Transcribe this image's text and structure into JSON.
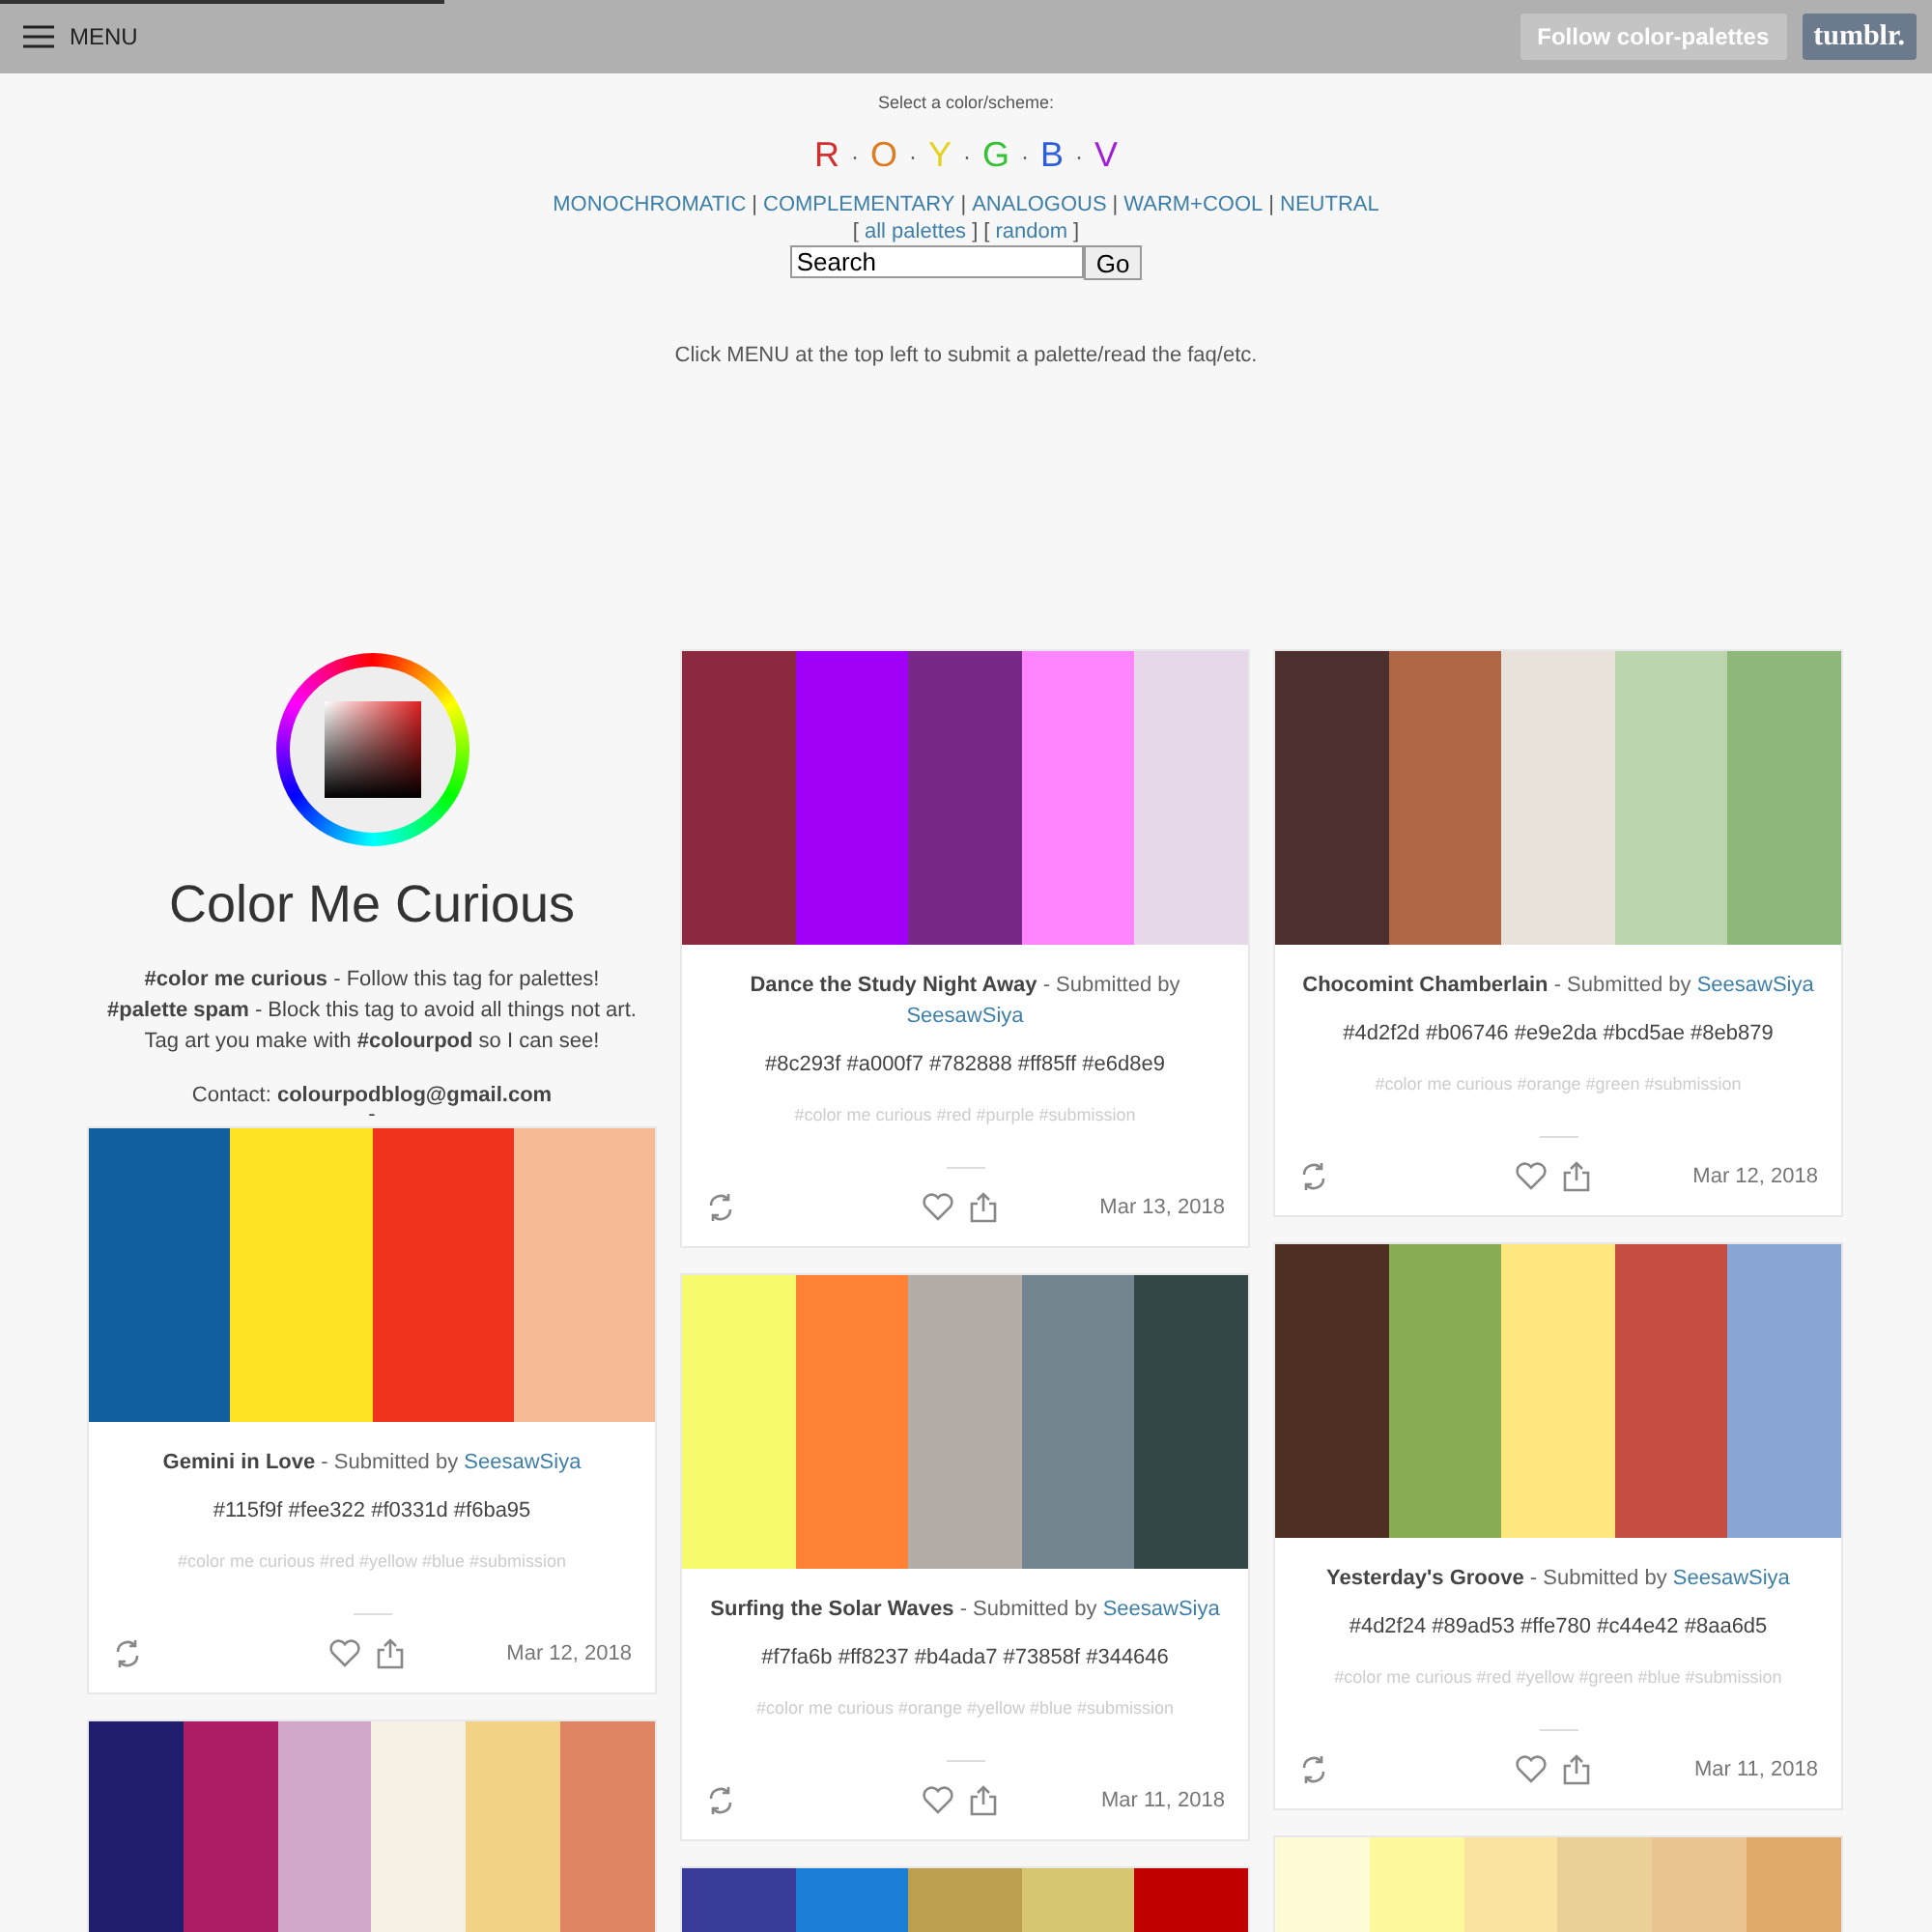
{
  "topbar": {
    "progress": {
      "level": 0.23
    },
    "menu_label": "MENU",
    "follow_button": "Follow color-palettes",
    "tumblr_button": "tumblr."
  },
  "header": {
    "prompt": "Select a color/scheme:",
    "letters": [
      {
        "kind": "letter",
        "text": "R",
        "color": "#d32f2f"
      },
      {
        "kind": "sep",
        "text": "·"
      },
      {
        "kind": "letter",
        "text": "O",
        "color": "#e07b20"
      },
      {
        "kind": "sep",
        "text": "·"
      },
      {
        "kind": "letter",
        "text": "Y",
        "color": "#e6d21c"
      },
      {
        "kind": "sep",
        "text": "·"
      },
      {
        "kind": "letter",
        "text": "G",
        "color": "#35c335"
      },
      {
        "kind": "sep",
        "text": "·"
      },
      {
        "kind": "letter",
        "text": "B",
        "color": "#2f5fd8"
      },
      {
        "kind": "sep",
        "text": "·"
      },
      {
        "kind": "letter",
        "text": "V",
        "color": "#a020d8"
      }
    ],
    "schemes": [
      {
        "kind": "link",
        "text": "MONOCHROMATIC"
      },
      {
        "kind": "sep",
        "text": "|"
      },
      {
        "kind": "link",
        "text": "COMPLEMENTARY"
      },
      {
        "kind": "sep",
        "text": "|"
      },
      {
        "kind": "link",
        "text": "ANALOGOUS"
      },
      {
        "kind": "sep",
        "text": "|"
      },
      {
        "kind": "link",
        "text": "WARM+COOL"
      },
      {
        "kind": "sep",
        "text": "|"
      },
      {
        "kind": "link",
        "text": "NEUTRAL"
      }
    ],
    "extra": [
      {
        "kind": "sep",
        "text": "["
      },
      {
        "kind": "link",
        "text": "all palettes"
      },
      {
        "kind": "sep",
        "text": "] ["
      },
      {
        "kind": "link",
        "text": "random"
      },
      {
        "kind": "sep",
        "text": "]"
      }
    ],
    "search": {
      "value": "Search",
      "button": "Go"
    },
    "note": "Click MENU at the top left to submit a palette/read the faq/etc."
  },
  "profile": {
    "title": "Color Me Curious",
    "lines": [
      "**#color me curious** - Follow this tag for palettes!",
      "**#palette spam** - Block this tag to avoid all things not art.",
      "Tag art you make with **#colourpod** so I can see!"
    ],
    "contact": "Contact: **colourpodblog@gmail.com**",
    "separator": "-"
  },
  "columns": [
    {
      "posts": [
        {
          "kind": "full",
          "swatches": [
            {
              "color": "#115f9f"
            },
            {
              "color": "#fee322"
            },
            {
              "color": "#f0331d"
            },
            {
              "color": "#f6ba95"
            }
          ],
          "title": "Gemini in Love",
          "by": " - Submitted by ",
          "submitter": "SeesawSiya",
          "hexes": "#115f9f #fee322 #f0331d #f6ba95",
          "tags": "#color me curious #red #yellow #blue #submission",
          "date": "Mar 12, 2018"
        },
        {
          "kind": "partial",
          "swatches": [
            {
              "color": "#1f1f6e"
            },
            {
              "color": "#ad1d66"
            },
            {
              "color": "#d3a9cb"
            },
            {
              "color": "#f6f1e4"
            },
            {
              "color": "#f2d285"
            },
            {
              "color": "#df8462"
            }
          ]
        }
      ]
    },
    {
      "posts": [
        {
          "kind": "full",
          "swatches": [
            {
              "color": "#8c293f"
            },
            {
              "color": "#a000f7"
            },
            {
              "color": "#782888"
            },
            {
              "color": "#ff85ff"
            },
            {
              "color": "#e6d8e9"
            }
          ],
          "title": "Dance the Study Night Away",
          "by": " - Submitted by ",
          "submitter": "SeesawSiya",
          "hexes": "#8c293f #a000f7 #782888 #ff85ff #e6d8e9",
          "tags": "#color me curious #red #purple #submission",
          "date": "Mar 13, 2018"
        },
        {
          "kind": "full",
          "swatches": [
            {
              "color": "#f7fa6b"
            },
            {
              "color": "#ff8237"
            },
            {
              "color": "#b4ada7"
            },
            {
              "color": "#73858f"
            },
            {
              "color": "#344646"
            }
          ],
          "title": "Surfing the Solar Waves",
          "by": " - Submitted by ",
          "submitter": "SeesawSiya",
          "hexes": "#f7fa6b #ff8237 #b4ada7 #73858f #344646",
          "tags": "#color me curious #orange #yellow #blue #submission",
          "date": "Mar 11, 2018"
        },
        {
          "kind": "partial",
          "swatches": [
            {
              "color": "#3a3c9a"
            },
            {
              "color": "#1b7fd6"
            },
            {
              "color": "#bca050"
            },
            {
              "color": "#d6c670"
            },
            {
              "color": "#c00000"
            }
          ]
        }
      ]
    },
    {
      "posts": [
        {
          "kind": "full",
          "swatches": [
            {
              "color": "#4d2f2d"
            },
            {
              "color": "#b06746"
            },
            {
              "color": "#e9e2da"
            },
            {
              "color": "#bcd5ae"
            },
            {
              "color": "#8eb879"
            }
          ],
          "title": "Chocomint Chamberlain",
          "by": " - Submitted by ",
          "submitter": "SeesawSiya",
          "hexes": "#4d2f2d #b06746 #e9e2da #bcd5ae #8eb879",
          "tags": "#color me curious #orange #green #submission",
          "date": "Mar 12, 2018"
        },
        {
          "kind": "full",
          "swatches": [
            {
              "color": "#4d2f24"
            },
            {
              "color": "#89ad53"
            },
            {
              "color": "#ffe780"
            },
            {
              "color": "#c44e42"
            },
            {
              "color": "#8aa6d5"
            }
          ],
          "title": "Yesterday's Groove",
          "by": " - Submitted by ",
          "submitter": "SeesawSiya",
          "hexes": "#4d2f24 #89ad53 #ffe780 #c44e42 #8aa6d5",
          "tags": "#color me curious #red #yellow #green #blue #submission",
          "date": "Mar 11, 2018"
        },
        {
          "kind": "partial",
          "swatches": [
            {
              "color": "#fffbd6"
            },
            {
              "color": "#fff99e"
            },
            {
              "color": "#fae2a1"
            },
            {
              "color": "#ead096"
            },
            {
              "color": "#ebc393"
            },
            {
              "color": "#e0ab6a"
            }
          ]
        }
      ]
    }
  ]
}
